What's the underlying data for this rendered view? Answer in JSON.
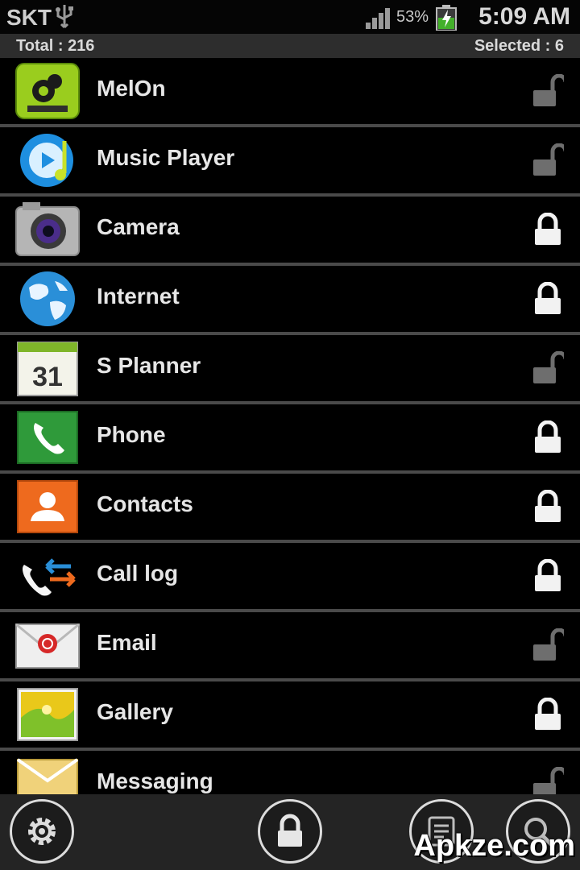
{
  "status_bar": {
    "carrier": "SKT",
    "battery_percent": "53%",
    "time": "5:09 AM"
  },
  "summary": {
    "total": "Total : 216",
    "selected": "Selected : 6"
  },
  "apps": [
    {
      "name": "MelOn",
      "locked": false,
      "icon": "melon-icon"
    },
    {
      "name": "Music Player",
      "locked": false,
      "icon": "music-player-icon"
    },
    {
      "name": "Camera",
      "locked": true,
      "icon": "camera-icon"
    },
    {
      "name": "Internet",
      "locked": true,
      "icon": "globe-icon"
    },
    {
      "name": "S Planner",
      "locked": false,
      "icon": "calendar-icon",
      "icon_text": "31"
    },
    {
      "name": "Phone",
      "locked": true,
      "icon": "phone-icon"
    },
    {
      "name": "Contacts",
      "locked": true,
      "icon": "contacts-icon"
    },
    {
      "name": "Call log",
      "locked": true,
      "icon": "call-log-icon"
    },
    {
      "name": "Email",
      "locked": false,
      "icon": "email-icon"
    },
    {
      "name": "Gallery",
      "locked": true,
      "icon": "gallery-icon"
    },
    {
      "name": "Messaging",
      "locked": false,
      "icon": "messaging-icon"
    }
  ],
  "watermark": "Apkze.com",
  "colors": {
    "background": "#000000",
    "separator": "#4a4a4a",
    "count_bar": "#2d2d2d",
    "bottom_bar": "#242424"
  }
}
